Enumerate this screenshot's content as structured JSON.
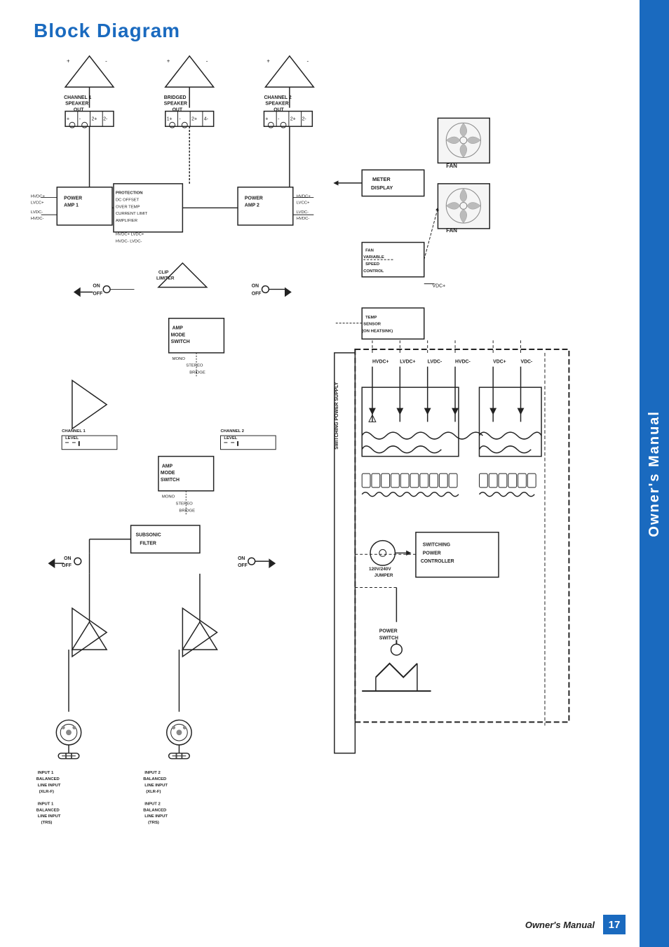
{
  "page": {
    "title": "Block Diagram",
    "sidebar_label": "Owner's Manual",
    "footer_label": "Owner's Manual",
    "footer_page": "17"
  },
  "diagram": {
    "title": "Block Diagram",
    "components": [
      "CHANNEL 1 SPEAKER OUT",
      "BRIDGED SPEAKER OUT",
      "CHANNEL 2 SPEAKER OUT",
      "POWER AMP 1",
      "POWER AMP 2",
      "PROTECTION DC OFFSET OVER TEMP CURRENT LIMIT AMPLIFIER",
      "CLIP LIMITER",
      "AMP MODE SWITCH",
      "SUBSONIC FILTER",
      "CHANNEL 1 LEVEL",
      "CHANNEL 2 LEVEL",
      "FAN",
      "METER DISPLAY",
      "FAN VARIABLE SPEED CONTROL",
      "TEMP SENSOR (ON HEATSINK)",
      "SWITCHING POWER SUPPLY",
      "SWITCHING POWER CONTROLLER",
      "120V/240V JUMPER",
      "POWER SWITCH",
      "INPUT 1 BALANCED LINE INPUT (XLR-F)",
      "INPUT 1 BALANCED LINE INPUT (TRS)",
      "INPUT 2 BALANCED LINE INPUT (XLR-F)",
      "INPUT 2 BALANCED LINE INPUT (TRS)"
    ]
  }
}
